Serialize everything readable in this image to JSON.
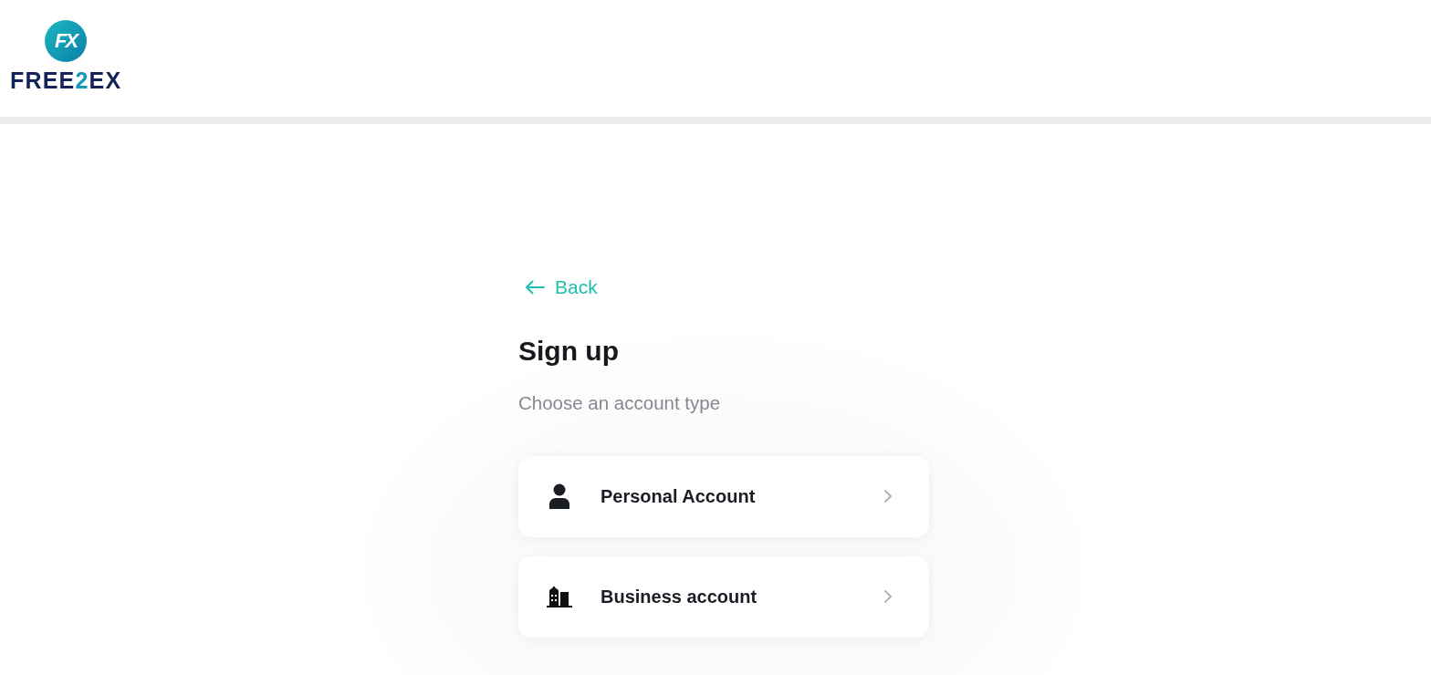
{
  "header": {
    "logo": {
      "mark": "FX",
      "wordmark": [
        {
          "text": "FREE",
          "accent": false
        },
        {
          "text": "2",
          "accent": true
        },
        {
          "text": "EX",
          "accent": false
        }
      ]
    }
  },
  "back_link": {
    "label": "Back"
  },
  "title": "Sign up",
  "subtitle": "Choose an account type",
  "account_types": [
    {
      "kind": "personal",
      "label": "Personal Account"
    },
    {
      "kind": "business",
      "label": "Business account"
    }
  ]
}
